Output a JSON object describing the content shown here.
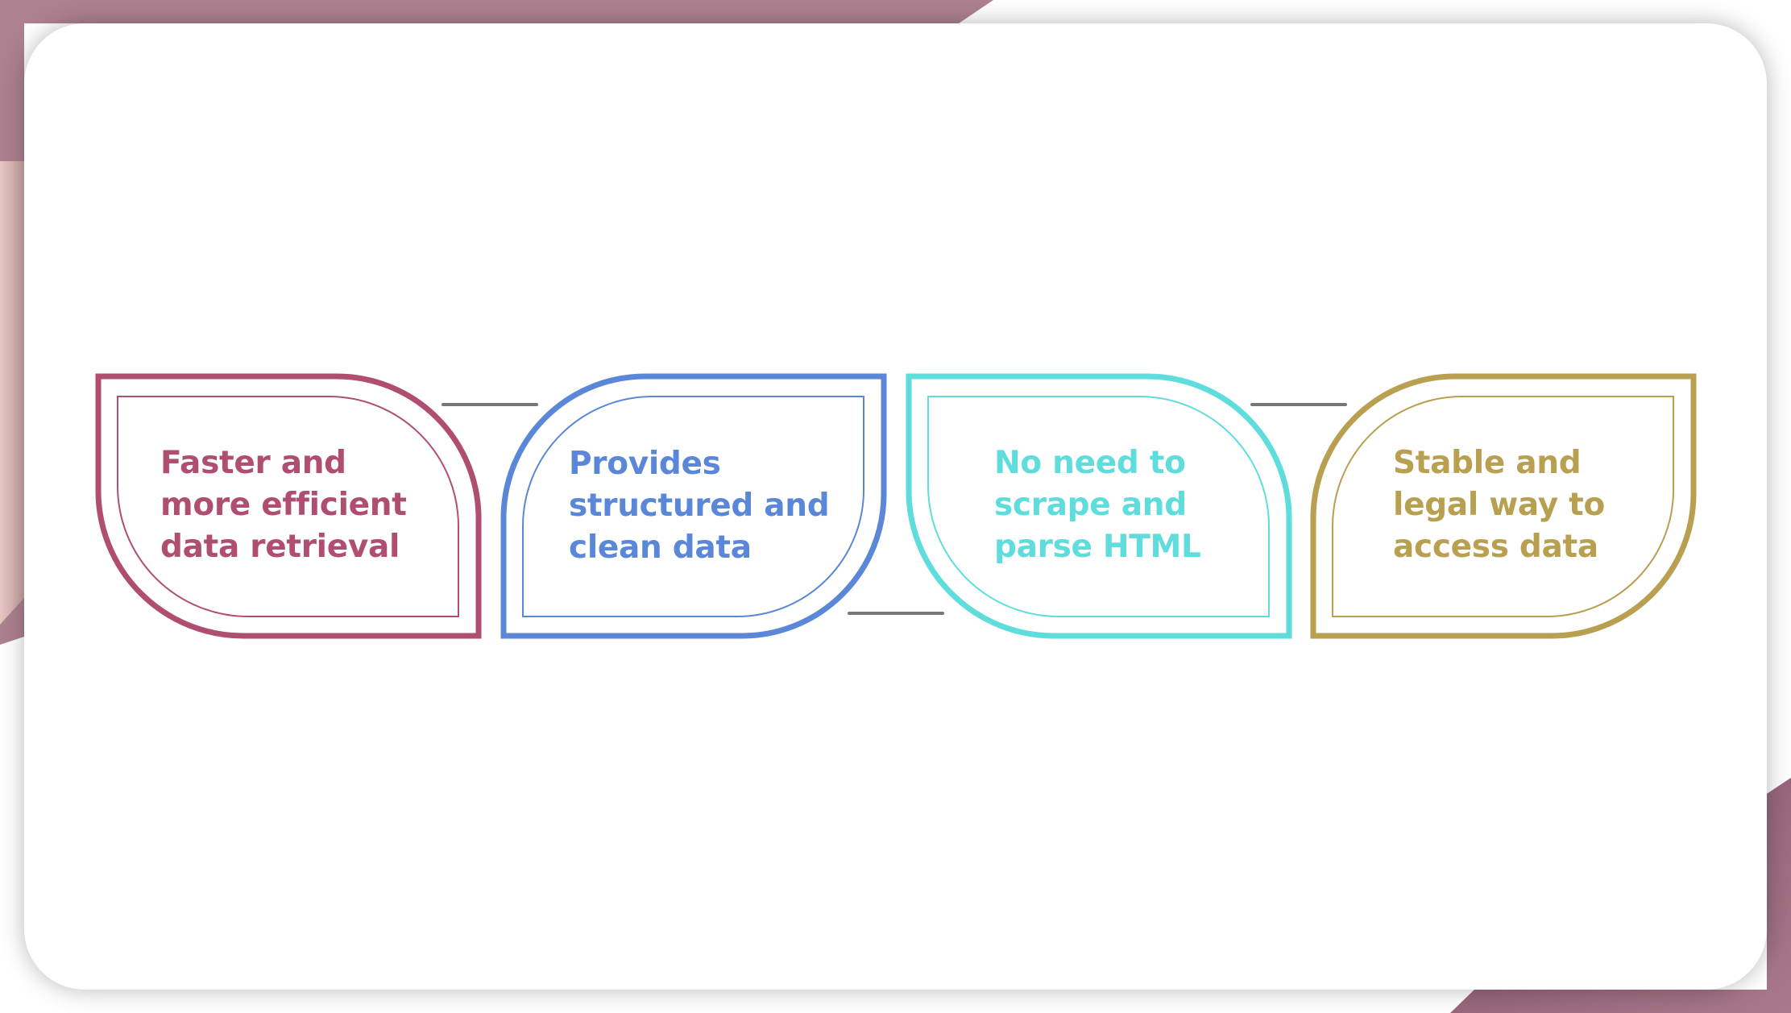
{
  "colors": {
    "background_band": "#ae8191",
    "background_pink": "#e6c7c5",
    "background_bottom_right": "#8e5f76",
    "connector": "#777777"
  },
  "cards": [
    {
      "text": "Faster and\nmore efficient\ndata retrieval",
      "color": "#b04e72",
      "shape": "leaf-right"
    },
    {
      "text": "Provides\nstructured and\nclean data",
      "color": "#5b87d8",
      "shape": "leaf-left"
    },
    {
      "text": "No need to\nscrape and\nparse HTML",
      "color": "#5fdcdc",
      "shape": "leaf-right"
    },
    {
      "text": "Stable and\nlegal way to\naccess data",
      "color": "#b99f50",
      "shape": "leaf-left"
    }
  ]
}
